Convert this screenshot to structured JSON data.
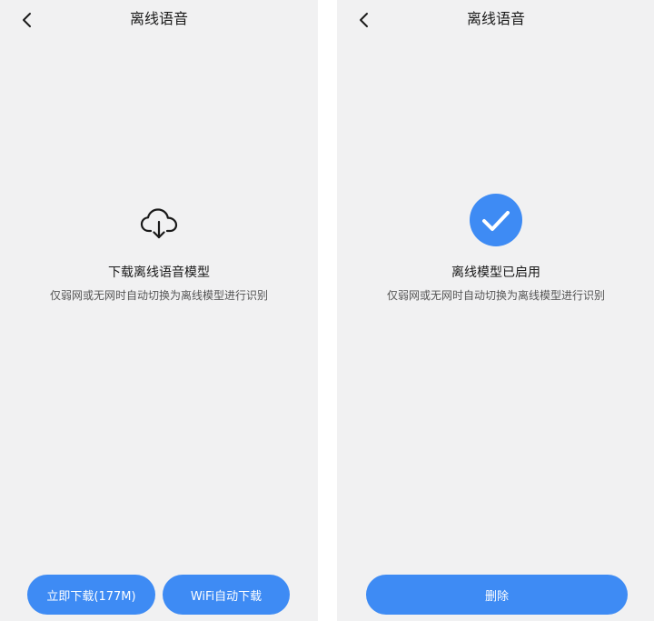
{
  "left_screen": {
    "nav": {
      "back_icon": "chevron-left-icon",
      "title": "离线语音"
    },
    "status_icon": "cloud-download-icon",
    "heading": "下载离线语音模型",
    "description": "仅弱网或无网时自动切换为离线模型进行识别",
    "buttons": {
      "download_now": "立即下载(177M)",
      "wifi_download": "WiFi自动下载"
    }
  },
  "right_screen": {
    "nav": {
      "back_icon": "chevron-left-icon",
      "title": "离线语音"
    },
    "status_icon": "check-circle-icon",
    "heading": "离线模型已启用",
    "description": "仅弱网或无网时自动切换为离线模型进行识别",
    "buttons": {
      "delete": "删除"
    }
  },
  "colors": {
    "accent": "#3e8bf4",
    "background": "#f1f1f2",
    "text_primary": "#1a1a1a",
    "text_secondary": "#555555"
  }
}
